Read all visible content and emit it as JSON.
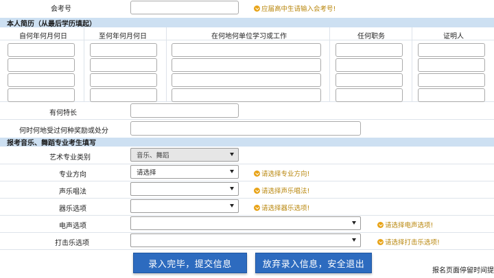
{
  "exam_no": {
    "label": "会考号",
    "hint": "应届高中生请输入会考号!"
  },
  "resume": {
    "section_title": "本人简历（从最后学历填起）",
    "columns": [
      "自何年何月何日",
      "至何年何月何日",
      "在何地何单位学习或工作",
      "任何职务",
      "证明人"
    ]
  },
  "specialty": {
    "label": "有何特长"
  },
  "awards": {
    "label": "何时何地受过何种奖励或处分"
  },
  "music": {
    "section_title": "报考音乐、舞蹈专业考生填写",
    "category": {
      "label": "艺术专业类别",
      "value": "音乐、舞蹈"
    },
    "direction": {
      "label": "专业方向",
      "value": "请选择",
      "hint": "请选择专业方向!"
    },
    "vocal": {
      "label": "声乐唱法",
      "hint": "请选择声乐唱法!"
    },
    "instrument": {
      "label": "器乐选项",
      "hint": "请选择器乐选项!"
    },
    "electro": {
      "label": "电声选项",
      "hint": "请选择电声选项!"
    },
    "percussion": {
      "label": "打击乐选项",
      "hint": "请选择打击乐选项!"
    }
  },
  "buttons": {
    "submit": "录入完毕，提交信息",
    "cancel": "放弃录入信息，安全退出"
  },
  "corner_text": "报名页面停留时间提",
  "colors": {
    "section_bg": "#cde0f2",
    "button_bg": "#2d6bbf",
    "hint": "#b8860b"
  }
}
